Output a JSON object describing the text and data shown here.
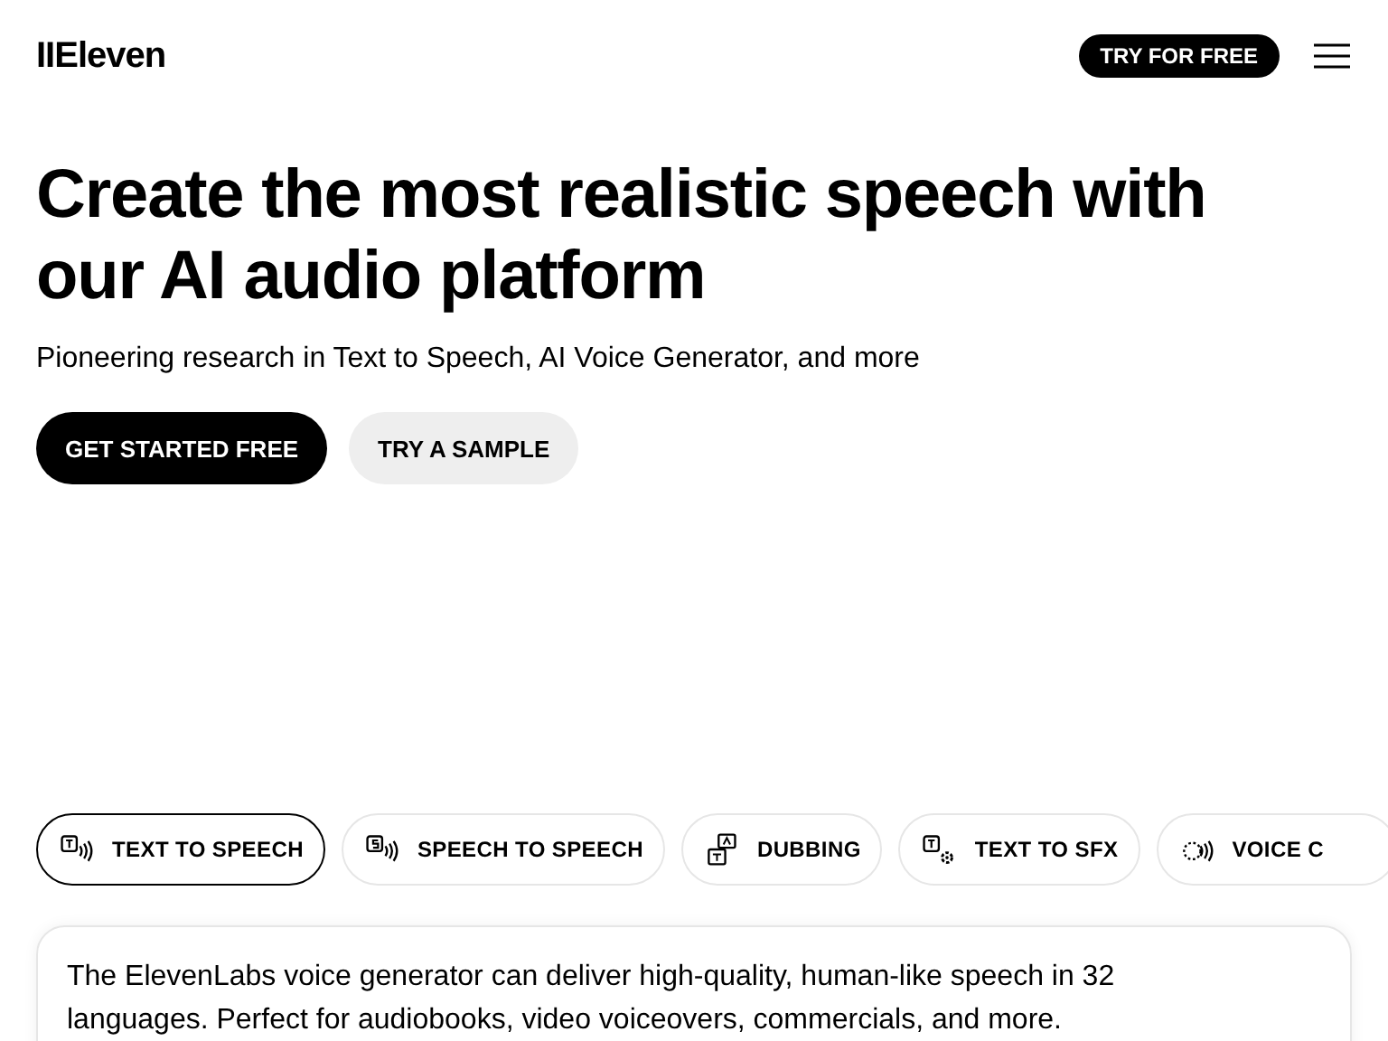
{
  "header": {
    "logo": "IIEleven",
    "cta": "TRY FOR FREE"
  },
  "hero": {
    "title": "Create the most realistic speech with our AI audio platform",
    "subtitle": "Pioneering research in Text to Speech, AI Voice Generator, and more",
    "buttons": [
      {
        "label": "GET STARTED FREE",
        "kind": "primary"
      },
      {
        "label": "TRY A SAMPLE",
        "kind": "secondary"
      }
    ]
  },
  "tabs": [
    {
      "label": "TEXT TO SPEECH",
      "kind": "tts",
      "selected": true
    },
    {
      "label": "SPEECH TO SPEECH",
      "kind": "sts",
      "selected": false
    },
    {
      "label": "DUBBING",
      "kind": "dubbing",
      "selected": false
    },
    {
      "label": "TEXT TO SFX",
      "kind": "sfx",
      "selected": false
    },
    {
      "label": "VOICE C",
      "kind": "voice",
      "selected": false
    }
  ],
  "card": {
    "text": "The ElevenLabs voice generator can deliver high-quality, human-like speech in 32 languages. Perfect for audiobooks, video voiceovers, commercials, and more."
  }
}
